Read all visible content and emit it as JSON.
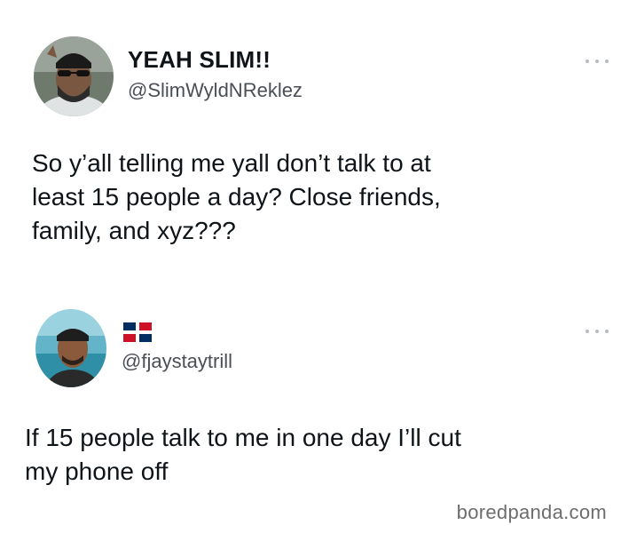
{
  "tweets": [
    {
      "display_name": "YEAH SLIM!!",
      "handle": "@SlimWyldNReklez",
      "text": "So y’all telling me yall don’t talk to at\nleast 15 people a day? Close friends,\nfamily, and xyz???",
      "more_icon": "more-horizontal-icon"
    },
    {
      "display_name": "",
      "flag_icon": "dominican-republic-flag-icon",
      "handle": "@fjaystaytrill",
      "text": "If 15 people talk to me in one day I’ll cut\nmy phone off",
      "more_icon": "more-horizontal-icon"
    }
  ],
  "watermark": "boredpanda.com",
  "colors": {
    "text": "#0f1419",
    "handle": "#4a4f55",
    "background": "#ffffff",
    "dots": "#b6bbc1",
    "watermark": "#6d6d6d"
  }
}
